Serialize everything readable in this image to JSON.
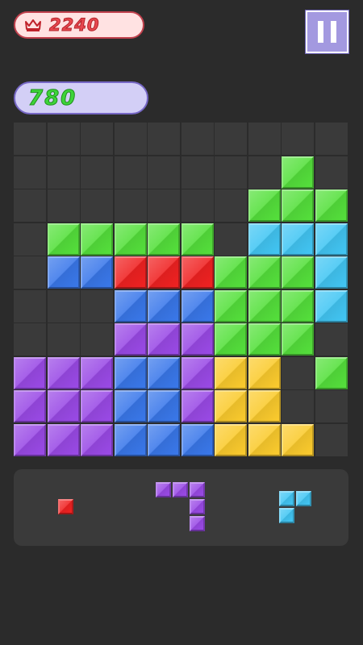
{
  "header": {
    "best_score": "2240",
    "current_score": "780",
    "crown_icon": "crown-icon",
    "pause_icon": "pause-icon"
  },
  "colors": {
    "empty": "#3a3a3a",
    "red": "#f02222",
    "green": "#55e03c",
    "blue": "#3a78ea",
    "purple": "#9a4ae6",
    "yellow": "#fbcb2e",
    "cyan": "#42c6f4"
  },
  "board": {
    "columns": 10,
    "rows": 10,
    "grid": [
      [
        ".",
        ".",
        ".",
        ".",
        ".",
        ".",
        ".",
        ".",
        ".",
        "."
      ],
      [
        ".",
        ".",
        ".",
        ".",
        ".",
        ".",
        ".",
        ".",
        "G",
        "."
      ],
      [
        ".",
        ".",
        ".",
        ".",
        ".",
        ".",
        ".",
        "G",
        "G",
        "G"
      ],
      [
        ".",
        "G",
        "G",
        "G",
        "G",
        "G",
        ".",
        "C",
        "C",
        "C"
      ],
      [
        ".",
        "B",
        "B",
        "R",
        "R",
        "R",
        "G",
        "G",
        "G",
        "C"
      ],
      [
        ".",
        ".",
        ".",
        "B",
        "B",
        "B",
        "G",
        "G",
        "G",
        "C"
      ],
      [
        ".",
        ".",
        ".",
        "P",
        "P",
        "P",
        "G",
        "G",
        "G",
        "."
      ],
      [
        "P",
        "P",
        "P",
        "B",
        "B",
        "P",
        "Y",
        "Y",
        ".",
        "G"
      ],
      [
        "P",
        "P",
        "P",
        "B",
        "B",
        "P",
        "Y",
        "Y",
        ".",
        "."
      ],
      [
        "P",
        "P",
        "P",
        "B",
        "B",
        "B",
        "Y",
        "Y",
        "Y",
        "."
      ]
    ]
  },
  "tray": {
    "pieces": [
      {
        "color": "red",
        "shape": [
          [
            1
          ]
        ]
      },
      {
        "color": "purple",
        "shape": [
          [
            1,
            1,
            1
          ],
          [
            0,
            0,
            1
          ],
          [
            0,
            0,
            1
          ]
        ]
      },
      {
        "color": "cyan",
        "shape": [
          [
            1,
            1
          ],
          [
            1,
            0
          ]
        ]
      }
    ]
  }
}
